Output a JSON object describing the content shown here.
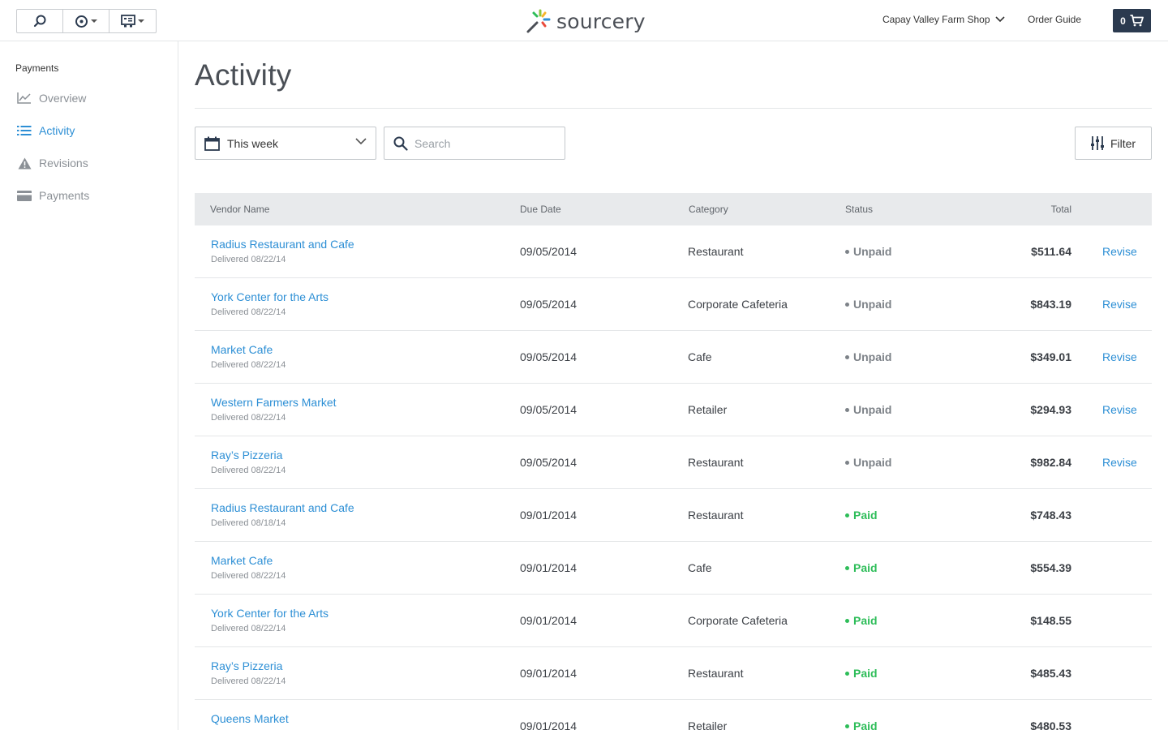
{
  "toolbar": {
    "buttons": [
      {
        "icon": "search-icon"
      },
      {
        "icon": "compass-icon",
        "dropdown": true
      },
      {
        "icon": "calculator-icon",
        "dropdown": true
      }
    ]
  },
  "brand": {
    "name": "sourcery"
  },
  "header": {
    "shop_name": "Capay Valley Farm Shop",
    "order_guide": "Order Guide",
    "cart_count": "0"
  },
  "sidebar": {
    "section": "Payments",
    "items": [
      {
        "label": "Overview",
        "icon": "line-chart-icon",
        "active": false
      },
      {
        "label": "Activity",
        "icon": "list-icon",
        "active": true
      },
      {
        "label": "Revisions",
        "icon": "warning-icon",
        "active": false
      },
      {
        "label": "Payments",
        "icon": "credit-card-icon",
        "active": false
      }
    ]
  },
  "main": {
    "title": "Activity",
    "date_range": "This week",
    "search_placeholder": "Search",
    "filter_label": "Filter"
  },
  "table": {
    "columns": [
      "Vendor Name",
      "Due Date",
      "Category",
      "Status",
      "Total"
    ],
    "revise_label": "Revise",
    "rows": [
      {
        "vendor": "Radius Restaurant and Cafe",
        "delivered": "Delivered 08/22/14",
        "due": "09/05/2014",
        "category": "Restaurant",
        "status": "Unpaid",
        "total": "$511.64",
        "revise": true
      },
      {
        "vendor": "York Center for the Arts",
        "delivered": "Delivered 08/22/14",
        "due": "09/05/2014",
        "category": "Corporate Cafeteria",
        "status": "Unpaid",
        "total": "$843.19",
        "revise": true
      },
      {
        "vendor": "Market Cafe",
        "delivered": "Delivered 08/22/14",
        "due": "09/05/2014",
        "category": "Cafe",
        "status": "Unpaid",
        "total": "$349.01",
        "revise": true
      },
      {
        "vendor": "Western Farmers Market",
        "delivered": "Delivered 08/22/14",
        "due": "09/05/2014",
        "category": "Retailer",
        "status": "Unpaid",
        "total": "$294.93",
        "revise": true
      },
      {
        "vendor": "Ray’s Pizzeria",
        "delivered": "Delivered 08/22/14",
        "due": "09/05/2014",
        "category": "Restaurant",
        "status": "Unpaid",
        "total": "$982.84",
        "revise": true
      },
      {
        "vendor": "Radius Restaurant and Cafe",
        "delivered": "Delivered 08/18/14",
        "due": "09/01/2014",
        "category": "Restaurant",
        "status": "Paid",
        "total": "$748.43",
        "revise": false
      },
      {
        "vendor": "Market Cafe",
        "delivered": "Delivered 08/22/14",
        "due": "09/01/2014",
        "category": "Cafe",
        "status": "Paid",
        "total": "$554.39",
        "revise": false
      },
      {
        "vendor": "York Center for the Arts",
        "delivered": "Delivered 08/22/14",
        "due": "09/01/2014",
        "category": "Corporate Cafeteria",
        "status": "Paid",
        "total": "$148.55",
        "revise": false
      },
      {
        "vendor": "Ray’s Pizzeria",
        "delivered": "Delivered 08/22/14",
        "due": "09/01/2014",
        "category": "Restaurant",
        "status": "Paid",
        "total": "$485.43",
        "revise": false
      },
      {
        "vendor": "Queens Market",
        "delivered": "",
        "due": "09/01/2014",
        "category": "Retailer",
        "status": "Paid",
        "total": "$480.53",
        "revise": false
      }
    ]
  },
  "colors": {
    "link": "#2d8fd5",
    "unpaid": "#7d8288",
    "paid": "#2ebd59",
    "cart_bg": "#2b3a4f",
    "header_bg": "#e8eaec"
  }
}
